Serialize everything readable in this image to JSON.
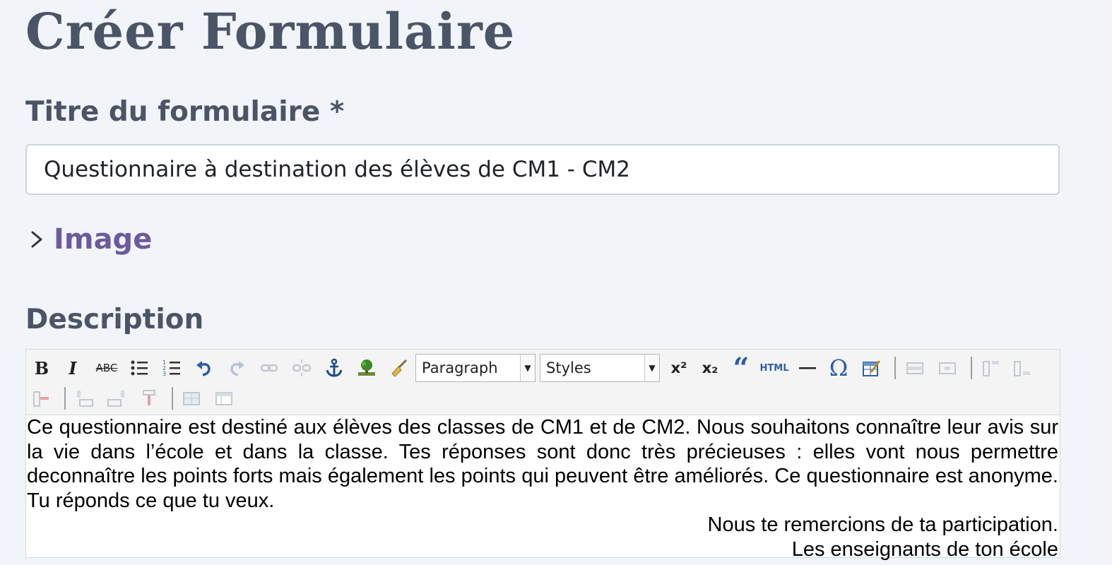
{
  "page": {
    "title": "Créer Formulaire"
  },
  "form": {
    "title_label": "Titre du formulaire *",
    "title_value": "Questionnaire à destination des élèves de CM1 - CM2",
    "image_label": "Image",
    "description_label": "Description"
  },
  "editor": {
    "toolbar": {
      "bold": "B",
      "italic": "I",
      "strike": "ABC",
      "superscript": "x²",
      "subscript": "x₂",
      "html": "HTML",
      "format_select": "Paragraph",
      "styles_select": "Styles"
    },
    "content": {
      "paragraph": "Ce questionnaire est destiné aux élèves des classes de CM1 et de CM2. Nous souhaitons connaître leur avis sur la vie dans l’école et dans la classe. Tes réponses sont donc très précieuses : elles vont nous permettre deconnaître les points forts mais également les points qui peuvent être améliorés. Ce questionnaire est anonyme. Tu réponds ce que tu veux.",
      "thanks": "Nous te remercions de ta participation.",
      "signature": "Les enseignants de ton école"
    }
  },
  "colors": {
    "background": "#f1f5f9",
    "label": "#4b5567",
    "image_link": "#6d5a9c"
  }
}
